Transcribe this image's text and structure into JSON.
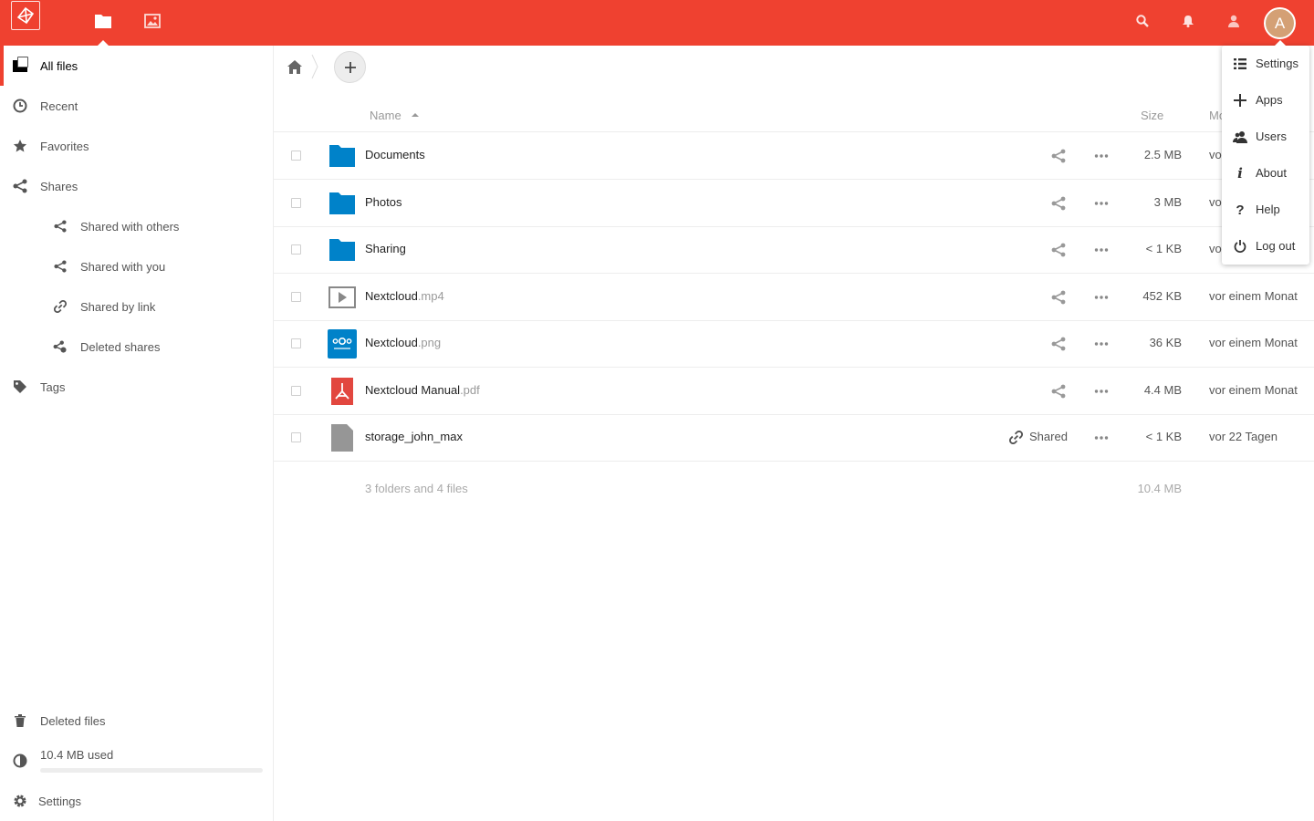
{
  "colors": {
    "brand": "#ef4130",
    "folder": "#0082c9",
    "pdf": "#e2473f",
    "text_muted": "#999999"
  },
  "header": {
    "apps": [
      {
        "name": "files",
        "icon": "folder-icon",
        "active": true
      },
      {
        "name": "gallery",
        "icon": "image-icon",
        "active": false
      }
    ],
    "right_icons": [
      "search-icon",
      "bell-icon",
      "contacts-icon"
    ],
    "avatar_initial": "A"
  },
  "sidebar": {
    "items": [
      {
        "label": "All files",
        "icon": "folder-icon"
      },
      {
        "label": "Recent",
        "icon": "clock-icon"
      },
      {
        "label": "Favorites",
        "icon": "star-icon"
      },
      {
        "label": "Shares",
        "icon": "share-icon"
      },
      {
        "label": "Shared with others",
        "icon": "share-icon"
      },
      {
        "label": "Shared with you",
        "icon": "share-icon"
      },
      {
        "label": "Shared by link",
        "icon": "link-icon"
      },
      {
        "label": "Deleted shares",
        "icon": "deleted-share-icon"
      },
      {
        "label": "Tags",
        "icon": "tag-icon"
      }
    ],
    "deleted_files": "Deleted files",
    "quota_text": "10.4 MB used",
    "settings": "Settings"
  },
  "files": {
    "header": {
      "name": "Name",
      "size": "Size",
      "modified": "Mo"
    },
    "rows": [
      {
        "name": "Documents",
        "ext": "",
        "type": "folder",
        "shared_label": "",
        "size": "2.5 MB",
        "modified": "vo"
      },
      {
        "name": "Photos",
        "ext": "",
        "type": "folder",
        "shared_label": "",
        "size": "3 MB",
        "modified": "vo"
      },
      {
        "name": "Sharing",
        "ext": "",
        "type": "folder",
        "shared_label": "",
        "size": "< 1 KB",
        "modified": "vo"
      },
      {
        "name": "Nextcloud",
        "ext": ".mp4",
        "type": "video",
        "shared_label": "",
        "size": "452 KB",
        "modified": "vor einem Monat"
      },
      {
        "name": "Nextcloud",
        "ext": ".png",
        "type": "image",
        "shared_label": "",
        "size": "36 KB",
        "modified": "vor einem Monat"
      },
      {
        "name": "Nextcloud Manual",
        "ext": ".pdf",
        "type": "pdf",
        "shared_label": "",
        "size": "4.4 MB",
        "modified": "vor einem Monat"
      },
      {
        "name": "storage_john_max",
        "ext": "",
        "type": "file",
        "shared_label": "Shared",
        "size": "< 1 KB",
        "modified": "vor 22 Tagen"
      }
    ],
    "summary": {
      "text": "3 folders and 4 files",
      "size": "10.4 MB"
    }
  },
  "user_menu": {
    "items": [
      {
        "label": "Settings",
        "icon": "settings-list-icon"
      },
      {
        "label": "Apps",
        "icon": "plus-icon"
      },
      {
        "label": "Users",
        "icon": "users-icon"
      },
      {
        "label": "About",
        "icon": "info-icon"
      },
      {
        "label": "Help",
        "icon": "help-icon"
      },
      {
        "label": "Log out",
        "icon": "power-icon"
      }
    ]
  }
}
